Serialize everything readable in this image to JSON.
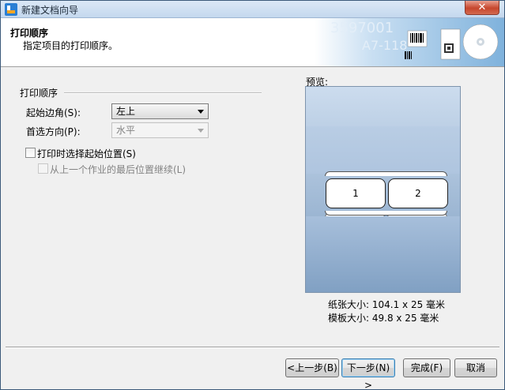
{
  "window": {
    "title": "新建文档向导",
    "close_label": "✕"
  },
  "header": {
    "title": "打印顺序",
    "subtitle": "指定项目的打印顺序。",
    "banner_text_1": "3597001",
    "banner_text_2": "A7-118"
  },
  "form": {
    "group_title": "打印顺序",
    "start_corner_label": "起始边角(S):",
    "start_corner_value": "左上",
    "direction_label": "首选方向(P):",
    "direction_value": "水平",
    "choose_start_label": "打印时选择起始位置(S)",
    "continue_last_label": "从上一个作业的最后位置继续(L)"
  },
  "preview": {
    "label": "预览:",
    "cells": [
      "1",
      "2"
    ],
    "paper_size": "纸张大小: 104.1 x 25 毫米",
    "template_size": "模板大小: 49.8 x 25 毫米"
  },
  "buttons": {
    "back": "<上一步(B)",
    "next": "下一步(N) >",
    "finish": "完成(F)",
    "cancel": "取消"
  },
  "colors": {
    "preview_top": "#ccdcee",
    "preview_bottom": "#7f9fc2",
    "default_button_border": "#3c7fb1"
  }
}
